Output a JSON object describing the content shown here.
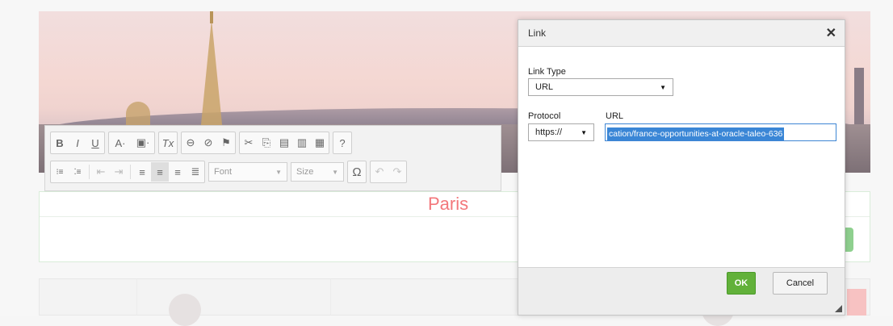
{
  "hero": {
    "caption": "Paris"
  },
  "toolbar": {
    "row1": [
      {
        "label": "B",
        "name": "bold-button"
      },
      {
        "label": "I",
        "name": "italic-button"
      },
      {
        "label": "U",
        "name": "underline-button"
      },
      {
        "label": "A·",
        "name": "text-color-button"
      },
      {
        "label": "▣·",
        "name": "background-color-button"
      },
      {
        "label": "Tx",
        "name": "remove-format-button"
      },
      {
        "label": "⊖",
        "name": "link-button"
      },
      {
        "label": "⊘",
        "name": "unlink-button"
      },
      {
        "label": "⚑",
        "name": "anchor-button"
      },
      {
        "label": "✂",
        "name": "cut-button"
      },
      {
        "label": "⎘",
        "name": "copy-button"
      },
      {
        "label": "▤",
        "name": "paste-button"
      },
      {
        "label": "▥",
        "name": "paste-text-button"
      },
      {
        "label": "▦",
        "name": "paste-word-button"
      },
      {
        "label": "?",
        "name": "help-button"
      }
    ],
    "row2": [
      {
        "label": "⁝≡",
        "name": "numbered-list-button"
      },
      {
        "label": "⁚≡",
        "name": "bulleted-list-button"
      },
      {
        "label": "⇤",
        "name": "outdent-button"
      },
      {
        "label": "⇥",
        "name": "indent-button"
      },
      {
        "label": "≡",
        "name": "align-left-button"
      },
      {
        "label": "≡",
        "name": "align-center-button"
      },
      {
        "label": "≡",
        "name": "align-right-button"
      },
      {
        "label": "≣",
        "name": "justify-button"
      }
    ],
    "font_label": "Font",
    "size_label": "Size",
    "special_char": "Ω",
    "undo": "↶",
    "redo": "↷"
  },
  "dialog": {
    "title": "Link",
    "close": "✕",
    "link_type_label": "Link Type",
    "link_type_value": "URL",
    "protocol_label": "Protocol",
    "protocol_value": "https://",
    "url_label": "URL",
    "url_value": "cation/france-opportunities-at-oracle-taleo-636",
    "ok_label": "OK",
    "cancel_label": "Cancel"
  },
  "colors": {
    "accent_green": "#62b13a",
    "caption_red": "#f3777b",
    "selection_blue": "#3a86d6"
  }
}
